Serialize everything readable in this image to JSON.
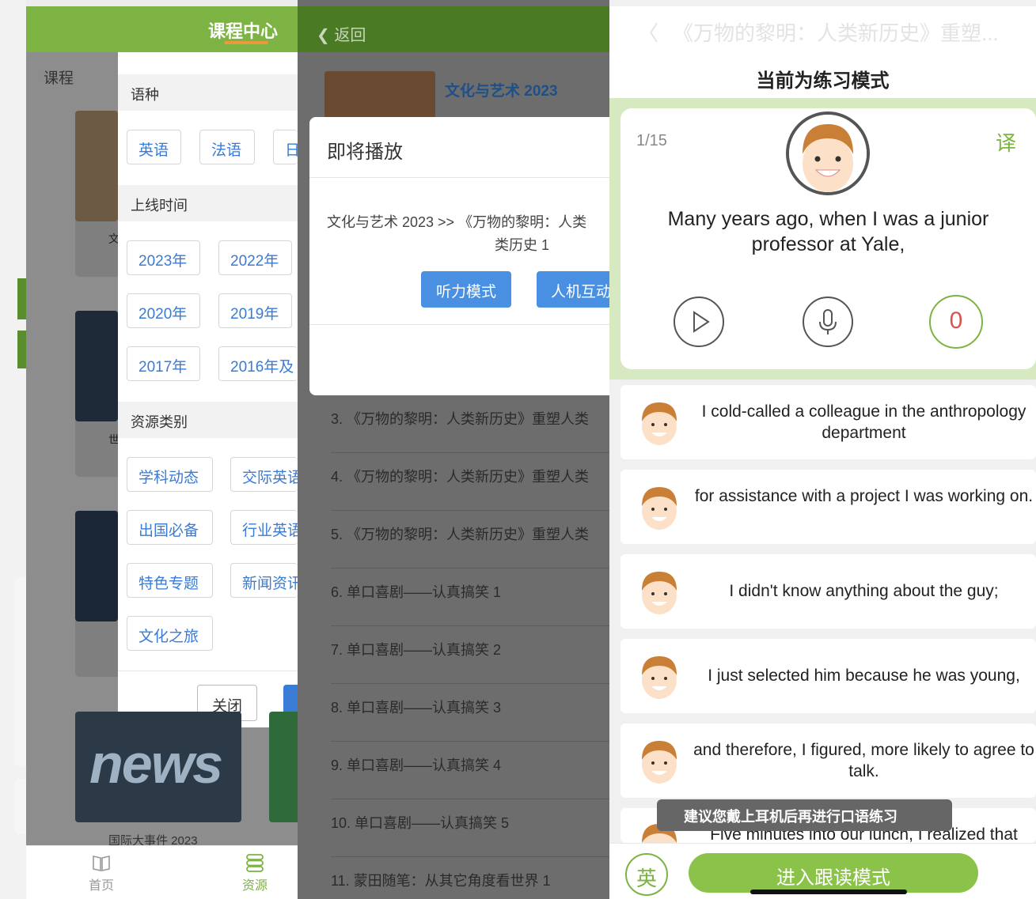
{
  "panel1": {
    "header_title": "课程中心",
    "course_label": "课程",
    "filter": {
      "language_section": "语种",
      "languages": [
        "英语",
        "法语",
        "日"
      ],
      "time_section": "上线时间",
      "years": [
        "2023年",
        "2022年",
        "2020年",
        "2019年",
        "2017年",
        "2016年及"
      ],
      "category_section": "资源类别",
      "categories": [
        "学科动态",
        "交际英语",
        "出国必备",
        "行业英语",
        "特色专题",
        "新闻资讯",
        "文化之旅"
      ],
      "close_label": "关闭"
    },
    "partial_card_letters": [
      "文",
      "世"
    ],
    "news_word": "news",
    "news_label": "国际大事件 2023",
    "tabs": [
      {
        "label": "首页",
        "icon": "book-icon"
      },
      {
        "label": "资源",
        "icon": "stack-icon"
      }
    ],
    "colors": {
      "primary_green": "#7cb342",
      "accent_orange": "#e89a3c",
      "link_blue": "#3a7bd5"
    }
  },
  "panel2": {
    "back_label": "返回",
    "card_title": "文化与艺术 2023",
    "dialog": {
      "title": "即将播放",
      "text_line1": "文化与艺术 2023 >> 《万物的黎明：人类",
      "text_line2": "类历史 1",
      "listen_mode": "听力模式",
      "interactive_mode": "人机互动"
    },
    "list": [
      "3. 《万物的黎明：人类新历史》重塑人类",
      "4. 《万物的黎明：人类新历史》重塑人类",
      "5. 《万物的黎明：人类新历史》重塑人类",
      "6. 单口喜剧——认真搞笑 1",
      "7. 单口喜剧——认真搞笑 2",
      "8. 单口喜剧——认真搞笑 3",
      "9. 单口喜剧——认真搞笑 4",
      "10. 单口喜剧——认真搞笑 5",
      "11. 蒙田随笔：从其它角度看世界 1"
    ]
  },
  "panel3": {
    "back_glyph": "〈",
    "title": "《万物的黎明：人类新历史》重塑...",
    "mode_label": "当前为练习模式",
    "counter": "1/15",
    "translate_label": "译",
    "sentence": "Many years ago, when I was a junior professor at Yale,",
    "score": "0",
    "items": [
      "I cold-called a colleague in the anthropology department",
      "for assistance with a project I was working on.",
      "I didn't know anything about the guy;",
      "I just selected him because he was young,",
      "and therefore, I figured, more likely to agree to talk.",
      "Five minutes into our lunch, I realized that"
    ],
    "toast": "建议您戴上耳机后再进行口语练习",
    "lang_toggle": "英",
    "follow_mode": "进入跟读模式"
  }
}
